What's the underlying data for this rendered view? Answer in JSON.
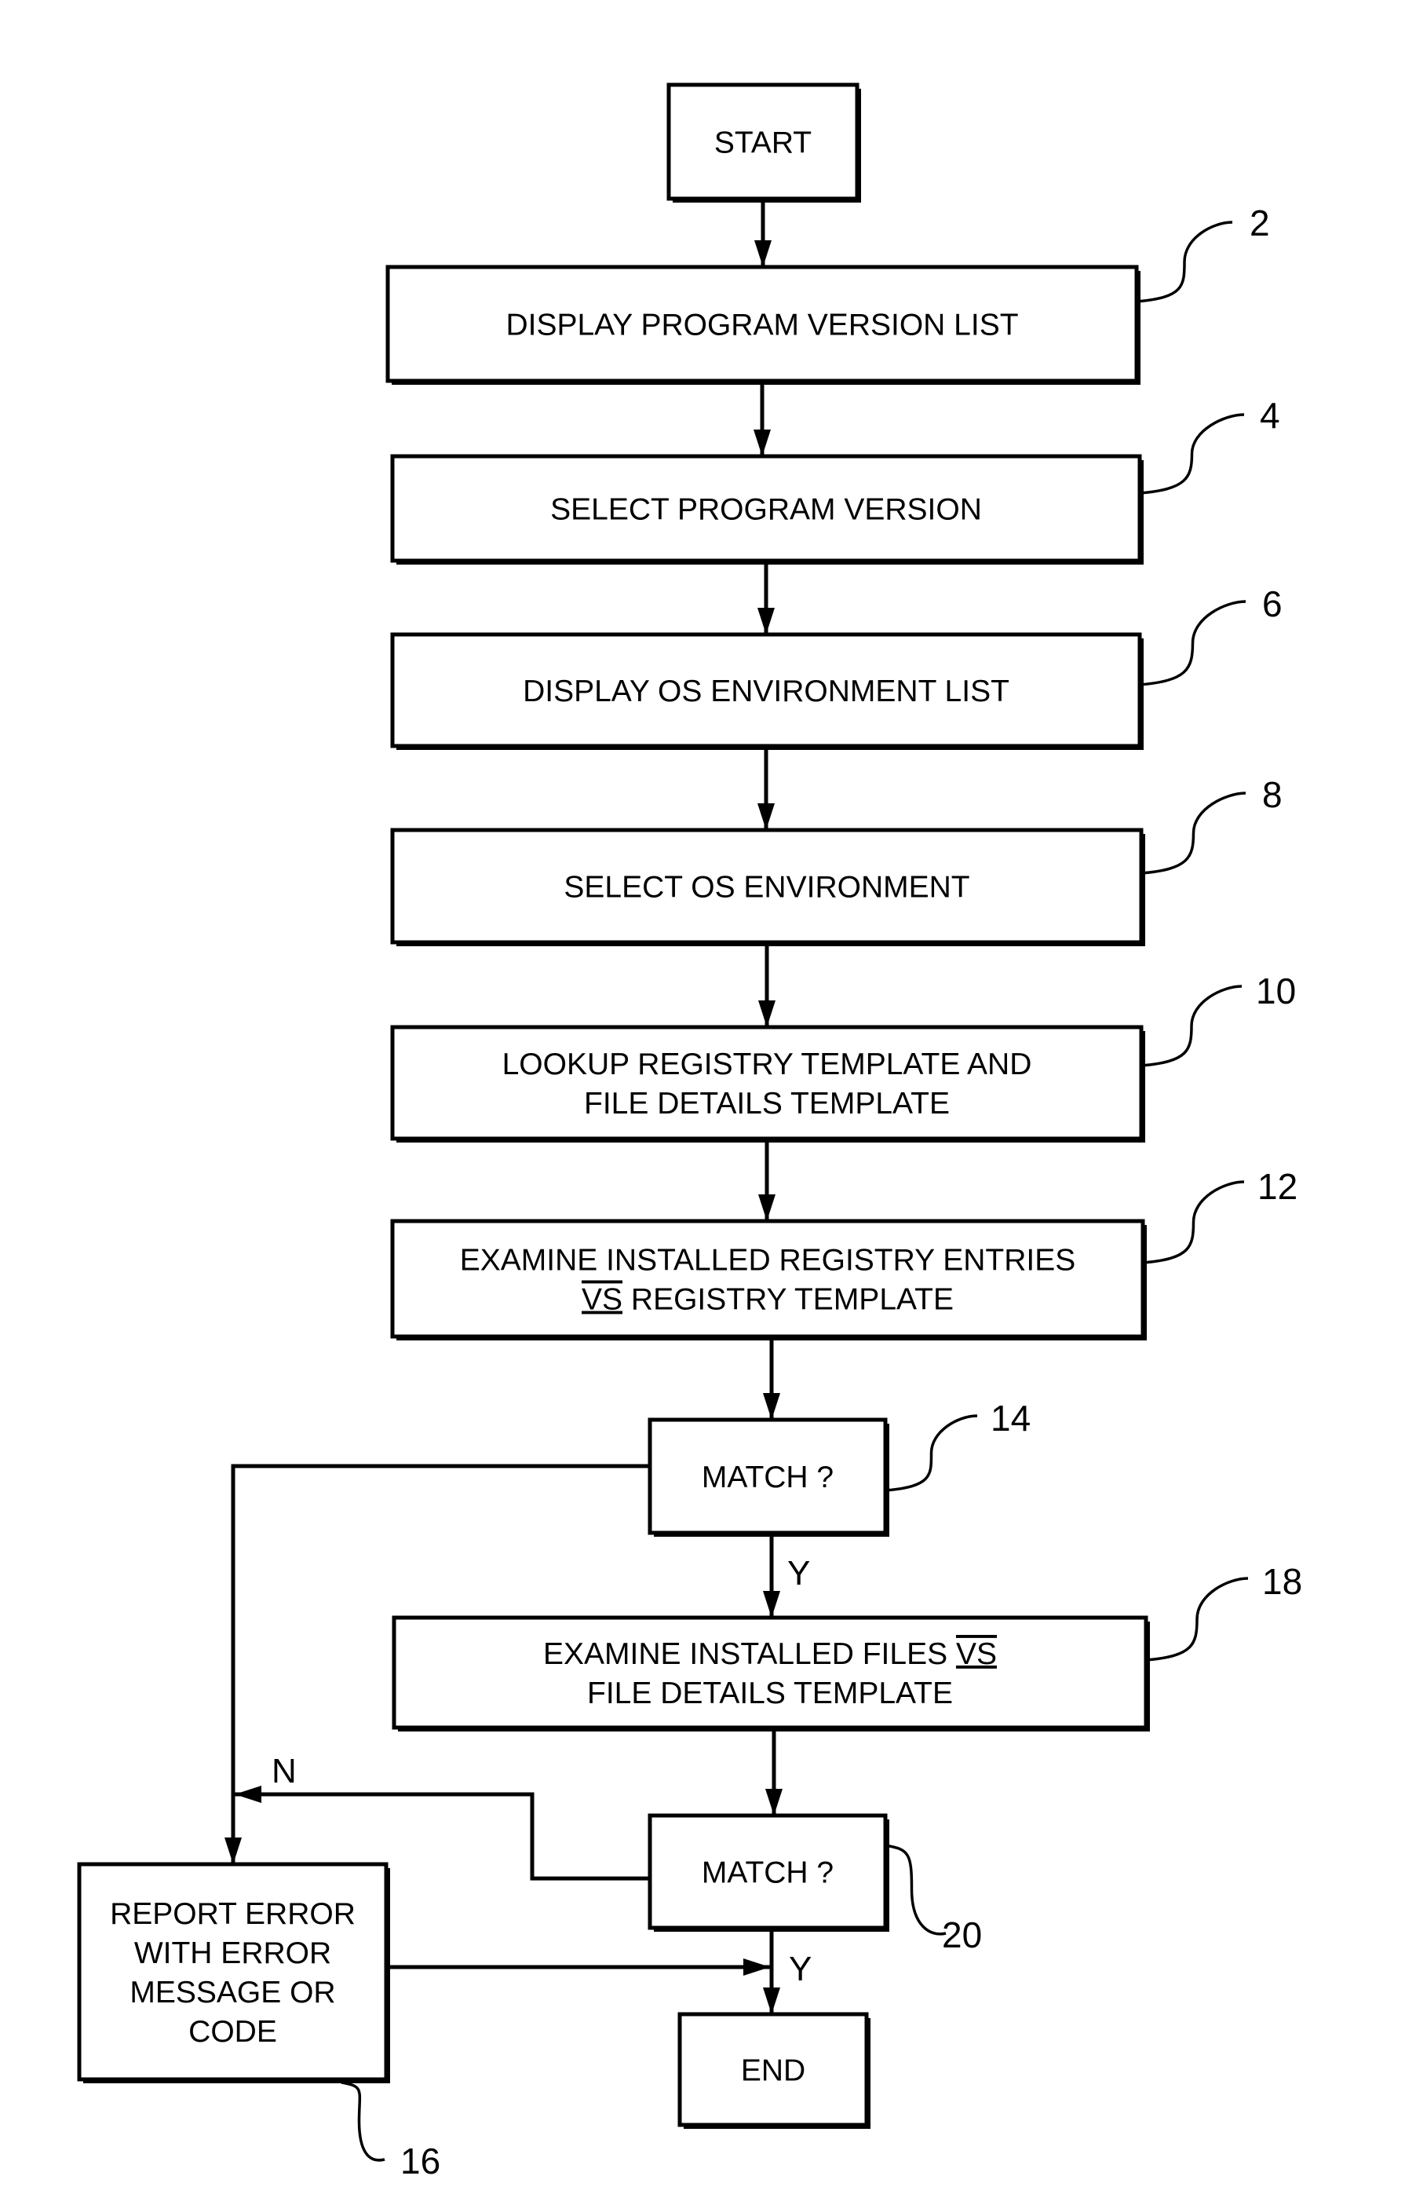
{
  "diagram": {
    "type": "flowchart",
    "steps": [
      {
        "id": "start",
        "ref": "",
        "lines": [
          "START"
        ]
      },
      {
        "id": "display-program-version-list",
        "ref": "2",
        "lines": [
          "DISPLAY PROGRAM VERSION LIST"
        ]
      },
      {
        "id": "select-program-version",
        "ref": "4",
        "lines": [
          "SELECT PROGRAM VERSION"
        ]
      },
      {
        "id": "display-os-environment-list",
        "ref": "6",
        "lines": [
          "DISPLAY OS ENVIRONMENT LIST"
        ]
      },
      {
        "id": "select-os-environment",
        "ref": "8",
        "lines": [
          "SELECT OS ENVIRONMENT"
        ]
      },
      {
        "id": "lookup-templates",
        "ref": "10",
        "lines": [
          "LOOKUP REGISTRY TEMPLATE AND",
          "FILE DETAILS TEMPLATE"
        ]
      },
      {
        "id": "examine-registry",
        "ref": "12",
        "lines": [
          "EXAMINE INSTALLED REGISTRY ENTRIES",
          "VS REGISTRY TEMPLATE"
        ],
        "emphasis": "VS"
      },
      {
        "id": "match-registry",
        "ref": "14",
        "lines": [
          "MATCH ?"
        ]
      },
      {
        "id": "examine-files",
        "ref": "18",
        "lines": [
          "EXAMINE INSTALLED FILES VS",
          "FILE DETAILS TEMPLATE"
        ],
        "emphasis": "VS"
      },
      {
        "id": "match-files",
        "ref": "20",
        "lines": [
          "MATCH ?"
        ]
      },
      {
        "id": "report-error",
        "ref": "16",
        "lines": [
          "REPORT ERROR",
          "WITH ERROR",
          "MESSAGE OR",
          "CODE"
        ]
      },
      {
        "id": "end",
        "ref": "",
        "lines": [
          "END"
        ]
      }
    ],
    "edges": [
      {
        "from": "start",
        "to": "display-program-version-list",
        "label": ""
      },
      {
        "from": "display-program-version-list",
        "to": "select-program-version",
        "label": ""
      },
      {
        "from": "select-program-version",
        "to": "display-os-environment-list",
        "label": ""
      },
      {
        "from": "display-os-environment-list",
        "to": "select-os-environment",
        "label": ""
      },
      {
        "from": "select-os-environment",
        "to": "lookup-templates",
        "label": ""
      },
      {
        "from": "lookup-templates",
        "to": "examine-registry",
        "label": ""
      },
      {
        "from": "examine-registry",
        "to": "match-registry",
        "label": ""
      },
      {
        "from": "match-registry",
        "to": "examine-files",
        "label": "Y"
      },
      {
        "from": "match-registry",
        "to": "report-error",
        "label": ""
      },
      {
        "from": "examine-files",
        "to": "match-files",
        "label": ""
      },
      {
        "from": "match-files",
        "to": "report-error",
        "label": "N"
      },
      {
        "from": "match-files",
        "to": "end",
        "label": "Y"
      },
      {
        "from": "report-error",
        "to": "end",
        "label": ""
      }
    ],
    "edge_labels": {
      "yes_1": "Y",
      "no": "N",
      "yes_2": "Y"
    }
  }
}
